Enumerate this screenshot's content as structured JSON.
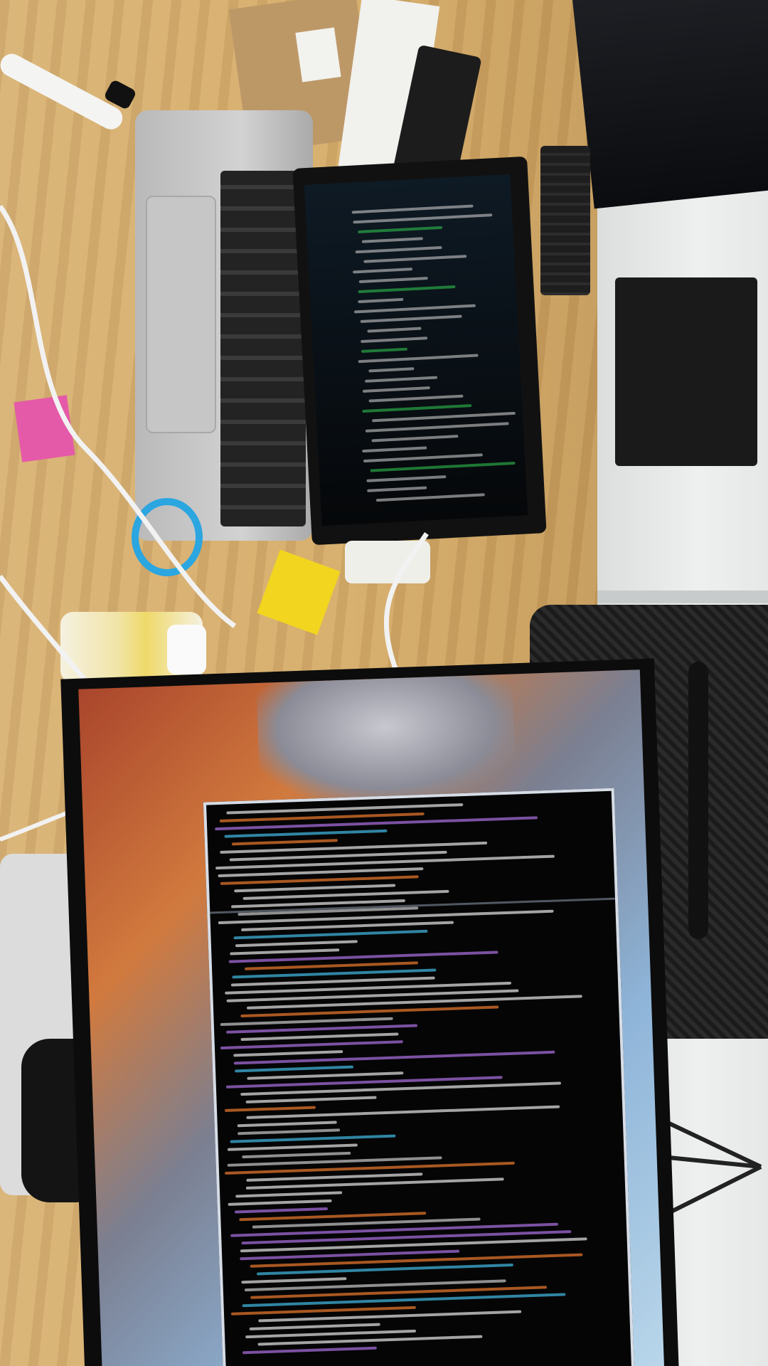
{
  "scene": {
    "description_labels": [],
    "palette": {
      "desk": "#d6ad6c",
      "wall": "#eef0ef",
      "monitor_bezel": "#0c0c0c",
      "terminal_bg": "#050505",
      "accent_orange": "#e0742c",
      "accent_purple": "#a36bd6",
      "accent_cyan": "#3fb0d8",
      "accent_green": "#2fbf4f"
    }
  }
}
